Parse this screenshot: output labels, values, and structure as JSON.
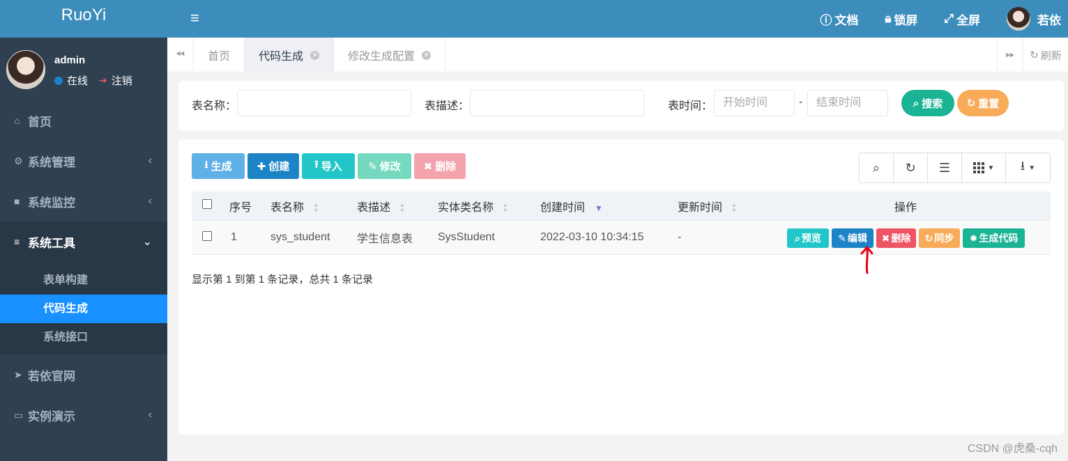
{
  "app": {
    "logo": "RuoYi"
  },
  "sidebar": {
    "user": {
      "name": "admin",
      "status": "在线",
      "logout": "注销"
    },
    "items": [
      {
        "label": "首页",
        "icon": "home-icon"
      },
      {
        "label": "系统管理",
        "icon": "gear-icon"
      },
      {
        "label": "系统监控",
        "icon": "video-icon"
      },
      {
        "label": "系统工具",
        "icon": "bars-icon"
      },
      {
        "label": "若依官网",
        "icon": "send-icon"
      },
      {
        "label": "实例演示",
        "icon": "desktop-icon"
      }
    ],
    "subitems": [
      {
        "label": "表单构建"
      },
      {
        "label": "代码生成"
      },
      {
        "label": "系统接口"
      }
    ]
  },
  "header": {
    "docs": "文档",
    "lock": "锁屏",
    "fullscreen": "全屏",
    "username": "若依"
  },
  "tabs": {
    "items": [
      {
        "label": "首页"
      },
      {
        "label": "代码生成"
      },
      {
        "label": "修改生成配置"
      }
    ],
    "refresh": "刷新"
  },
  "search": {
    "table_name_label": "表名称：",
    "table_desc_label": "表描述：",
    "time_label": "表时间：",
    "start_placeholder": "开始时间",
    "end_placeholder": "结束时间",
    "separator": "-",
    "search_btn": "搜索",
    "reset_btn": "重置"
  },
  "toolbar": {
    "generate": "生成",
    "create": "创建",
    "import": "导入",
    "edit": "修改",
    "delete": "删除"
  },
  "table": {
    "headers": [
      "序号",
      "表名称",
      "表描述",
      "实体类名称",
      "创建时间",
      "更新时间",
      "操作"
    ],
    "rows": [
      {
        "index": "1",
        "table_name": "sys_student",
        "table_desc": "学生信息表",
        "class_name": "SysStudent",
        "create_time": "2022-03-10 10:34:15",
        "update_time": "-"
      }
    ],
    "actions": {
      "preview": "预览",
      "edit": "编辑",
      "delete": "删除",
      "sync": "同步",
      "gen": "生成代码"
    },
    "summary": "显示第 1 到第 1 条记录，总共 1 条记录"
  },
  "colors": {
    "header_blue": "#3c8dbc",
    "sidebar_dark": "#2f4050",
    "active_blue": "#1890ff",
    "primary": "#1c84c6",
    "success": "#1ab394",
    "warning": "#f8ac59",
    "info": "#23c6c8",
    "danger": "#ed5565"
  },
  "watermark": "CSDN @虎桑-cqh"
}
